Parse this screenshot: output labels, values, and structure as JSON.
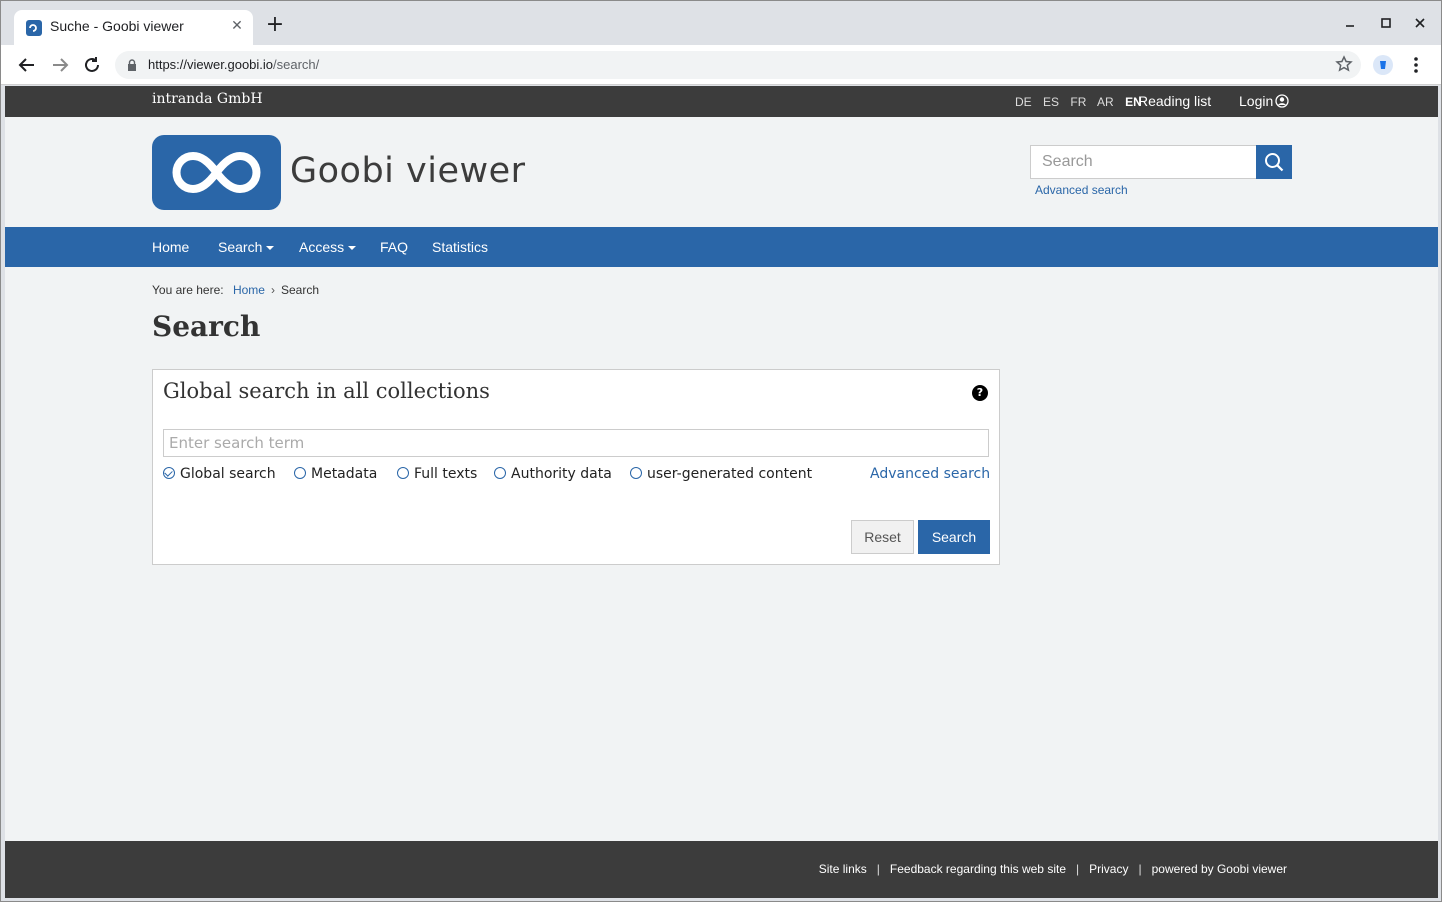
{
  "browser": {
    "tab_title": "Suche - Goobi viewer",
    "url_host": "https://viewer.goobi.io",
    "url_path": "/search/",
    "new_tab": "+",
    "tab_close": "✕",
    "icons": [
      "back-icon",
      "forward-icon",
      "reload-icon",
      "lock-icon",
      "star-icon",
      "profile-icon",
      "menu-icon",
      "minimize-icon",
      "maximize-icon",
      "close-icon"
    ]
  },
  "topbar": {
    "org": "intranda GmbH",
    "languages": [
      "DE",
      "ES",
      "FR",
      "AR",
      "EN"
    ],
    "active_language": "EN",
    "reading_list": "Reading list",
    "login": "Login"
  },
  "header": {
    "brand": "Goobi viewer",
    "search_placeholder": "Search",
    "advanced_search": "Advanced search"
  },
  "nav": {
    "items": [
      "Home",
      "Search",
      "Access",
      "FAQ",
      "Statistics"
    ]
  },
  "breadcrumb": {
    "prefix": "You are here:",
    "home": "Home",
    "current": "Search"
  },
  "main": {
    "title": "Search",
    "panel_title": "Global search in all collections",
    "help": "?",
    "term_placeholder": "Enter search term",
    "options": [
      "Global search",
      "Metadata",
      "Full texts",
      "Authority data",
      "user-generated content"
    ],
    "selected_option": "Global search",
    "advanced_search": "Advanced search",
    "reset": "Reset",
    "search": "Search"
  },
  "footer": {
    "links": [
      "Site links",
      "Feedback regarding this web site",
      "Privacy",
      "powered by Goobi viewer"
    ]
  },
  "colors": {
    "accent": "#2a66a8",
    "dark_bar": "#3c3c3c",
    "page_bg": "#f1f3f4"
  }
}
